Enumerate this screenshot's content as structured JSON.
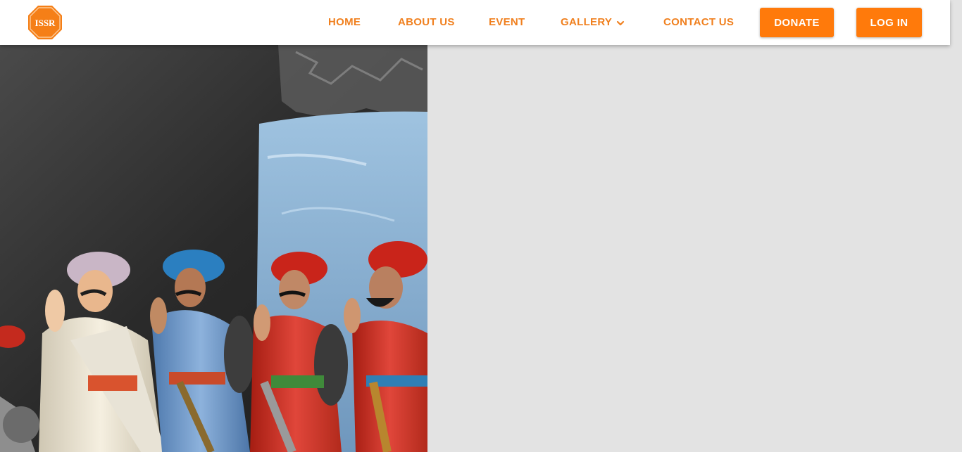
{
  "brand": {
    "logo_text": "ISSR"
  },
  "nav": {
    "home": "HOME",
    "about": "ABOUT US",
    "event": "EVENT",
    "gallery": "GALLERY",
    "contact": "CONTACT US"
  },
  "buttons": {
    "donate": "DONATE",
    "login": "LOG IN"
  },
  "colors": {
    "accent": "#f0801f",
    "button": "#ff7a0b",
    "background": "#e3e3e3"
  },
  "icons": {
    "gallery_dropdown": "chevron-down-icon"
  }
}
